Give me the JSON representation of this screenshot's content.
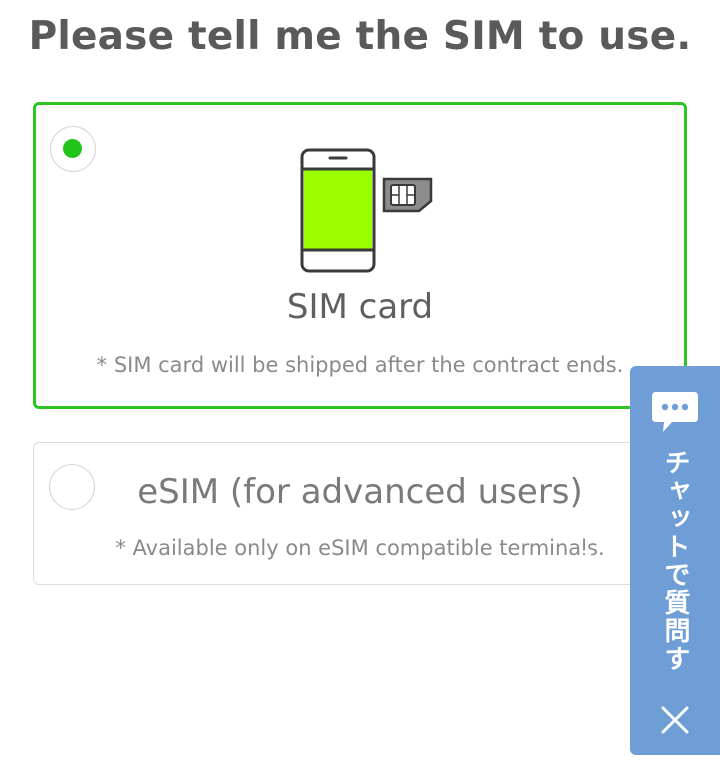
{
  "page": {
    "title": "Please tell me the SIM to use."
  },
  "options": [
    {
      "id": "sim-card",
      "label": "SIM card",
      "note": "* SIM card will be shipped after the contract ends.",
      "selected": true,
      "illustration_icon": "phone-with-sim-icon"
    },
    {
      "id": "esim",
      "label": "eSIM (for advanced users)",
      "note": "* Available only on eSIM compatible terminals.",
      "selected": false
    }
  ],
  "chat_widget": {
    "label": "チャットで質問する",
    "bubble_icon": "chat-bubble-icon",
    "close_icon": "close-icon"
  },
  "colors": {
    "accent_green": "#22c41a",
    "selected_border": "#2ec421",
    "phone_screen": "#9cff00",
    "chat_panel": "#6f9dd6",
    "title_text": "#5a5a5a"
  }
}
